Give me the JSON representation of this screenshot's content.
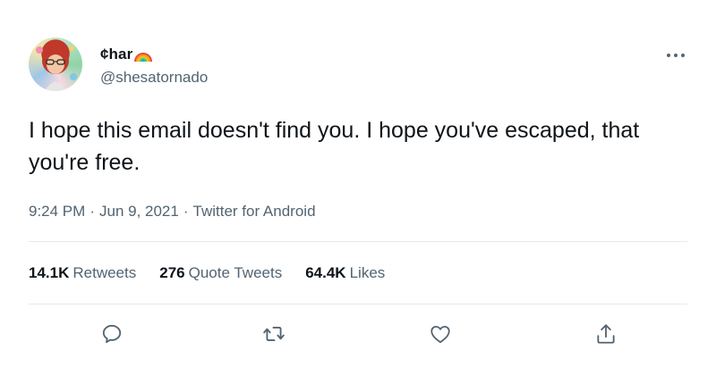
{
  "author": {
    "display_name": "¢har",
    "handle": "@shesatornado",
    "avatar_icon": "avatar",
    "name_emoji_icon": "rainbow-icon"
  },
  "tweet": {
    "text": "I hope this email doesn't find you. I hope you've escaped, that you're free.",
    "time": "9:24 PM",
    "date": "Jun 9, 2021",
    "source": "Twitter for Android",
    "separator": "·"
  },
  "stats": {
    "retweets": {
      "count": "14.1K",
      "label": "Retweets"
    },
    "quote_tweets": {
      "count": "276",
      "label": "Quote Tweets"
    },
    "likes": {
      "count": "64.4K",
      "label": "Likes"
    }
  },
  "actions": {
    "reply_icon": "reply-icon",
    "retweet_icon": "retweet-icon",
    "like_icon": "like-icon",
    "share_icon": "share-icon",
    "more_icon": "more-icon"
  },
  "colors": {
    "text_primary": "#0f1419",
    "text_secondary": "#536471",
    "divider": "#e7e9ea",
    "icon": "#536471"
  }
}
